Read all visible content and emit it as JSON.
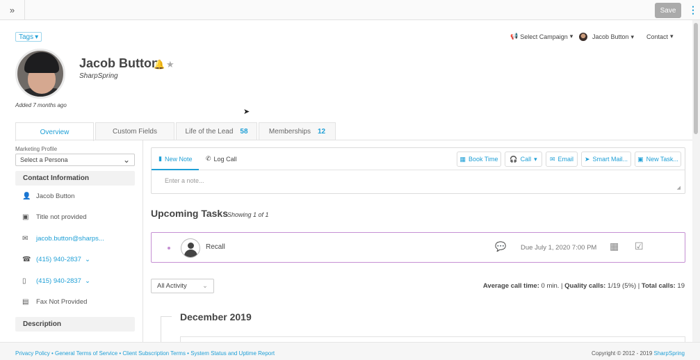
{
  "topbar": {
    "expand_glyph": "»",
    "save_label": "Save",
    "menu_glyph": "⋮"
  },
  "header": {
    "tags_label": "Tags",
    "select_campaign": "Select Campaign",
    "owner_name": "Jacob Button",
    "contact_label": "Contact"
  },
  "profile": {
    "name": "Jacob Button",
    "company": "SharpSpring",
    "added": "Added 7 months ago"
  },
  "tabs": [
    {
      "label": "Overview",
      "count": ""
    },
    {
      "label": "Custom Fields",
      "count": ""
    },
    {
      "label": "Life of the Lead",
      "count": "58"
    },
    {
      "label": "Memberships",
      "count": "12"
    }
  ],
  "sidebar": {
    "marketing_profile_label": "Marketing Profile",
    "persona_placeholder": "Select a Persona",
    "contact_info_title": "Contact Information",
    "contact_name": "Jacob Button",
    "title": "Title not provided",
    "email": "jacob.button@sharps...",
    "phone1": "(415) 940-2837",
    "phone2": "(415) 940-2837",
    "fax": "Fax Not Provided",
    "description_title": "Description"
  },
  "notes": {
    "new_note": "New Note",
    "log_call": "Log Call",
    "book_time": "Book Time",
    "call": "Call",
    "email": "Email",
    "smart_mail": "Smart Mail...",
    "new_task": "New Task...",
    "placeholder": "Enter a note..."
  },
  "tasks": {
    "title": "Upcoming Tasks",
    "showing": "Showing 1 of 1",
    "task_name": "Recall",
    "due": "Due July 1, 2020 7:00 PM"
  },
  "activity": {
    "filter": "All Activity",
    "avg_label": "Average call time:",
    "avg_value": "0 min.",
    "quality_label": "Quality calls:",
    "quality_value": "1/19 (5%)",
    "total_label": "Total calls:",
    "total_value": "19",
    "month": "December 2019"
  },
  "footer": {
    "links": "Privacy Policy • General Terms of Service • Client Subscription Terms • System Status and Uptime Report",
    "copyright": "Copyright © 2012 - 2019",
    "brand": "SharpSpring"
  },
  "colors": {
    "accent": "#1e9fd6",
    "task_border": "#c58fd3",
    "save_bg": "#aaaaaa"
  }
}
